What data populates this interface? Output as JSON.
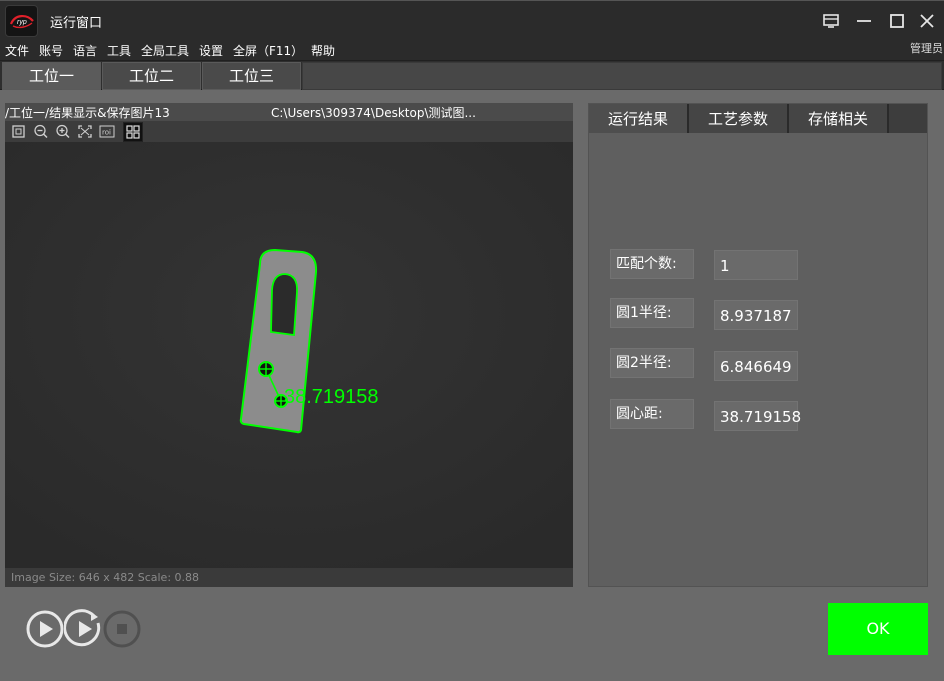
{
  "window": {
    "title": "运行窗口",
    "logo_icon": "app-logo-icon"
  },
  "menu": {
    "items": [
      "文件",
      "账号",
      "语言",
      "工具",
      "全局工具",
      "设置",
      "全屏（F11）",
      "帮助"
    ],
    "user": "管理员"
  },
  "station_tabs": [
    "工位一",
    "工位二",
    "工位三"
  ],
  "viewer": {
    "path": "/工位一/结果显示&保存图片13",
    "file_path": "C:\\Users\\309374\\Desktop\\测试图...",
    "status": "Image Size: 646 x 482 Scale: 0.88",
    "measurement_label": "38.719158",
    "overlay_color": "#00ff00",
    "tools": [
      "fit-icon",
      "zoom-out-icon",
      "zoom-in-icon",
      "fullscreen-icon",
      "roi-icon",
      "crosshair-icon"
    ],
    "roi_text": "roi"
  },
  "results": {
    "tabs": [
      "运行结果",
      "工艺参数",
      "存储相关"
    ],
    "rows": [
      {
        "label": "匹配个数:",
        "value": "1"
      },
      {
        "label": "圆1半径:",
        "value": "8.937187"
      },
      {
        "label": "圆2半径:",
        "value": "6.846649"
      },
      {
        "label": "圆心距:",
        "value": "38.719158"
      }
    ]
  },
  "controls": {
    "run_once_icon": "play-icon",
    "run_loop_icon": "play-loop-icon",
    "stop_icon": "stop-icon",
    "ok_label": "OK",
    "ok_color": "#00ff00"
  }
}
